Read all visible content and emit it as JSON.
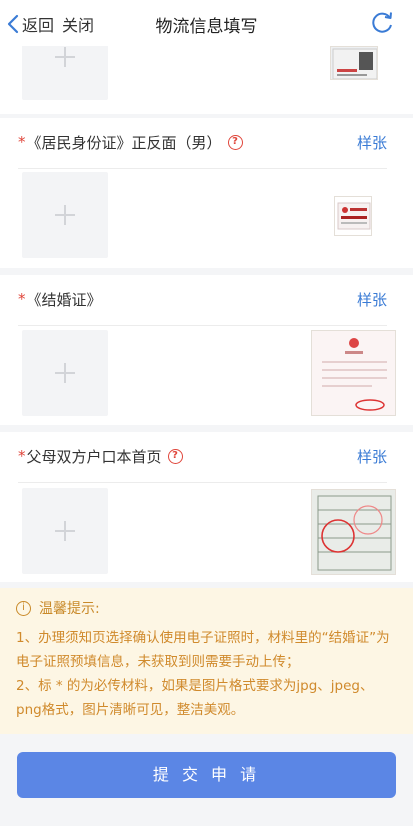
{
  "nav": {
    "back_label": "返回",
    "close_label": "关闭",
    "title": "物流信息填写"
  },
  "sections": [
    {
      "required": "*",
      "label": "《居民身份证》正反面（男）",
      "help": "?",
      "sample_label": "样张"
    },
    {
      "required": "*",
      "label": "《结婚证》",
      "help": "",
      "sample_label": "样张"
    },
    {
      "required": "*",
      "label": "父母双方户口本首页",
      "help": "?",
      "sample_label": "样张"
    }
  ],
  "tips": {
    "title": "温馨提示:",
    "line1": "1、办理须知页选择确认使用电子证照时，材料里的“结婚证”为电子证照预填信息，未获取到则需要手动上传；",
    "line2": "2、标 * 的为必传材料，如果是图片格式要求为jpg、jpeg、png格式，图片清晰可见，整洁美观。"
  },
  "submit_label": "提 交 申 请",
  "colors": {
    "accent": "#3a7bd5",
    "required": "#e0463b",
    "tip_text": "#d08a2c",
    "tip_bg": "#fdf6e4",
    "button": "#5b86e5"
  }
}
